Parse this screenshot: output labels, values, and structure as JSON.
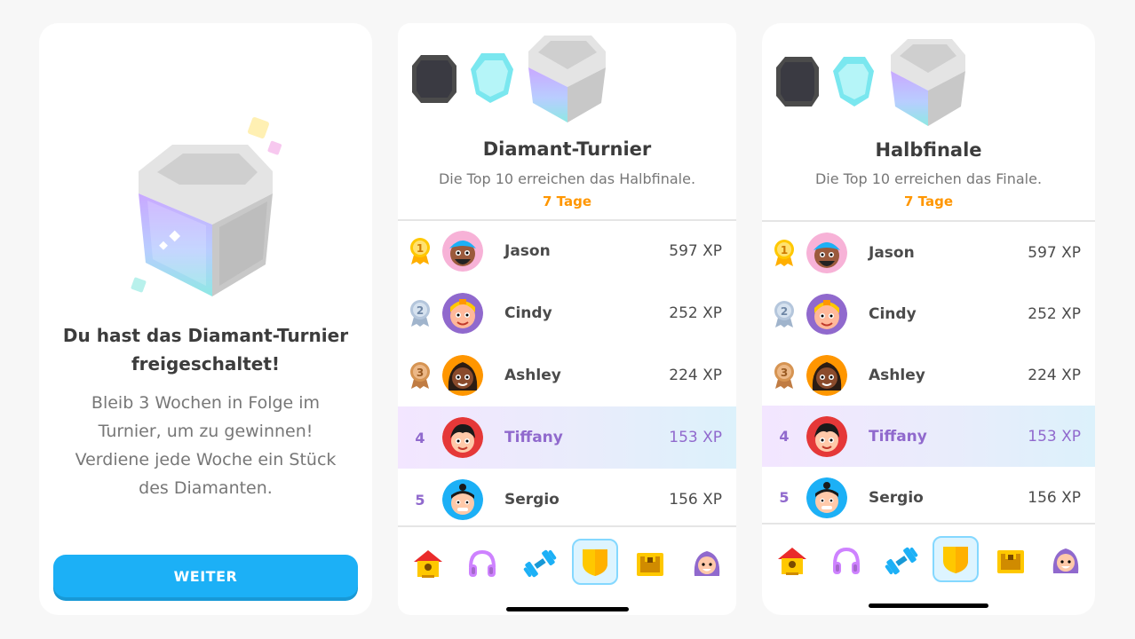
{
  "unlock": {
    "title_line1": "Du hast das Diamant-Turnier",
    "title_line2": "freigeschaltet!",
    "body_lines": [
      "Bleib 3 Wochen in Folge im",
      "Turnier, um zu gewinnen!",
      "Verdiene jede Woche ein Stück",
      "des Diamanten."
    ],
    "button_label": "WEITER"
  },
  "leagues": [
    {
      "title": "Diamant-Turnier",
      "subtitle": "Die Top 10 erreichen das Halbfinale.",
      "days": "7 Tage",
      "rows": [
        {
          "rank": "1",
          "name": "Jason",
          "xp": "597 XP"
        },
        {
          "rank": "2",
          "name": "Cindy",
          "xp": "252 XP"
        },
        {
          "rank": "3",
          "name": "Ashley",
          "xp": "224 XP"
        },
        {
          "rank": "4",
          "name": "Tiffany",
          "xp": "153 XP"
        },
        {
          "rank": "5",
          "name": "Sergio",
          "xp": "156 XP"
        }
      ]
    },
    {
      "title": "Halbfinale",
      "subtitle": "Die Top 10 erreichen das Finale.",
      "days": "7 Tage",
      "rows": [
        {
          "rank": "1",
          "name": "Jason",
          "xp": "597 XP"
        },
        {
          "rank": "2",
          "name": "Cindy",
          "xp": "252 XP"
        },
        {
          "rank": "3",
          "name": "Ashley",
          "xp": "224 XP"
        },
        {
          "rank": "4",
          "name": "Tiffany",
          "xp": "153 XP"
        },
        {
          "rank": "5",
          "name": "Sergio",
          "xp": "156 XP"
        }
      ]
    }
  ],
  "tabs": [
    "home-icon",
    "headphones-icon",
    "dumbbell-icon",
    "shield-icon",
    "treasure-chest-icon",
    "profile-icon"
  ],
  "colors": {
    "accent": "#1cb0f6",
    "days": "#ff9600",
    "highlight_text": "#9069cd",
    "gold": "#ffc800",
    "silver": "#b4c6dc",
    "bronze": "#d69452"
  }
}
